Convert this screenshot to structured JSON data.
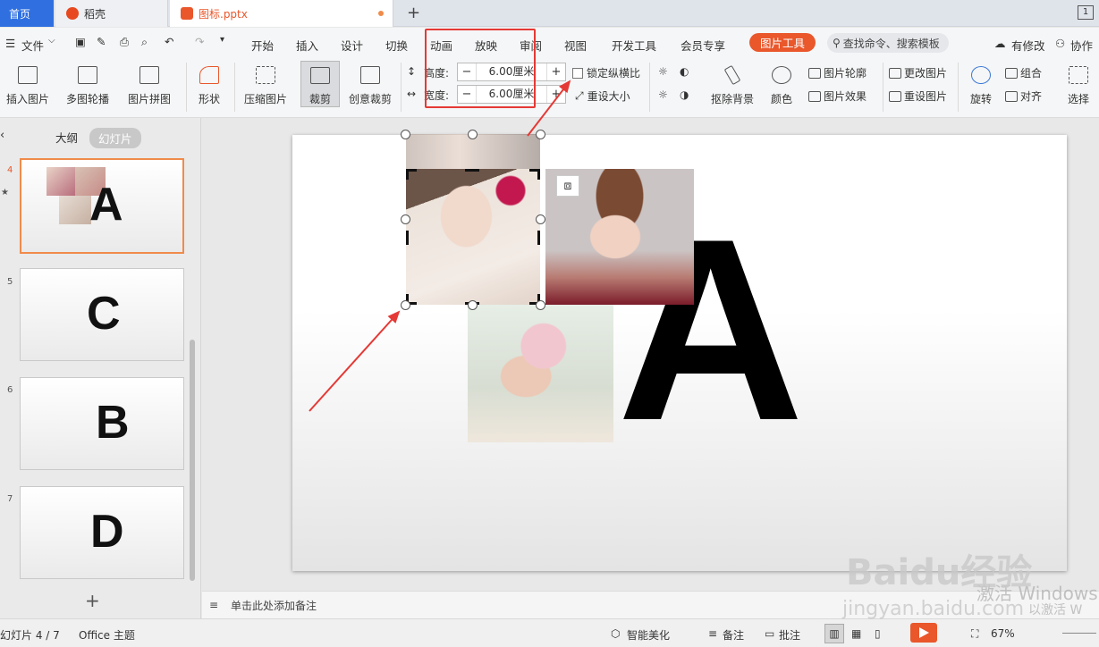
{
  "tabs": {
    "home": "首页",
    "docer": "稻壳",
    "file": "图标.pptx",
    "badge": "1"
  },
  "menu": {
    "file": "文件",
    "items": [
      "开始",
      "插入",
      "设计",
      "切换",
      "动画",
      "放映",
      "审阅",
      "视图",
      "开发工具",
      "会员专享"
    ],
    "picture_tools": "图片工具",
    "search": "查找命令、搜索模板",
    "modified": "有修改",
    "collaborate": "协作"
  },
  "ribbon": {
    "insert_picture": "插入图片",
    "multi_carousel": "多图轮播",
    "picture_collage": "图片拼图",
    "shape": "形状",
    "compress": "压缩图片",
    "crop": "裁剪",
    "creative_crop": "创意裁剪",
    "height_label": "高度:",
    "height_value": "6.00厘米",
    "width_label": "宽度:",
    "width_value": "6.00厘米",
    "lock_ratio": "锁定纵横比",
    "reset_size": "重设大小",
    "remove_bg": "抠除背景",
    "color": "颜色",
    "outline": "图片轮廓",
    "effects": "图片效果",
    "change_picture": "更改图片",
    "reset_picture": "重设图片",
    "rotate": "旋转",
    "group": "组合",
    "align": "对齐",
    "select": "选择"
  },
  "panel": {
    "outline_tab": "大纲",
    "slides_tab": "幻灯片"
  },
  "slides": [
    {
      "num": "4",
      "letter": "A"
    },
    {
      "num": "5",
      "letter": "C"
    },
    {
      "num": "6",
      "letter": "B"
    },
    {
      "num": "7",
      "letter": "D"
    }
  ],
  "slide_big_letter": "A",
  "notes_placeholder": "单击此处添加备注",
  "status": {
    "slide_counter": "幻灯片 4 / 7",
    "theme": "Office 主题",
    "beautify": "智能美化",
    "notes": "备注",
    "comments": "批注",
    "zoom": "67%"
  },
  "watermark": {
    "text1": "激活 Windows",
    "text2": "jingyan.baidu.com",
    "text3": "以激活 W",
    "brand": "Baidu经验"
  },
  "colors": {
    "accent": "#e9572b",
    "home_tab": "#2f6fe0",
    "annotation_red": "#e53935"
  }
}
